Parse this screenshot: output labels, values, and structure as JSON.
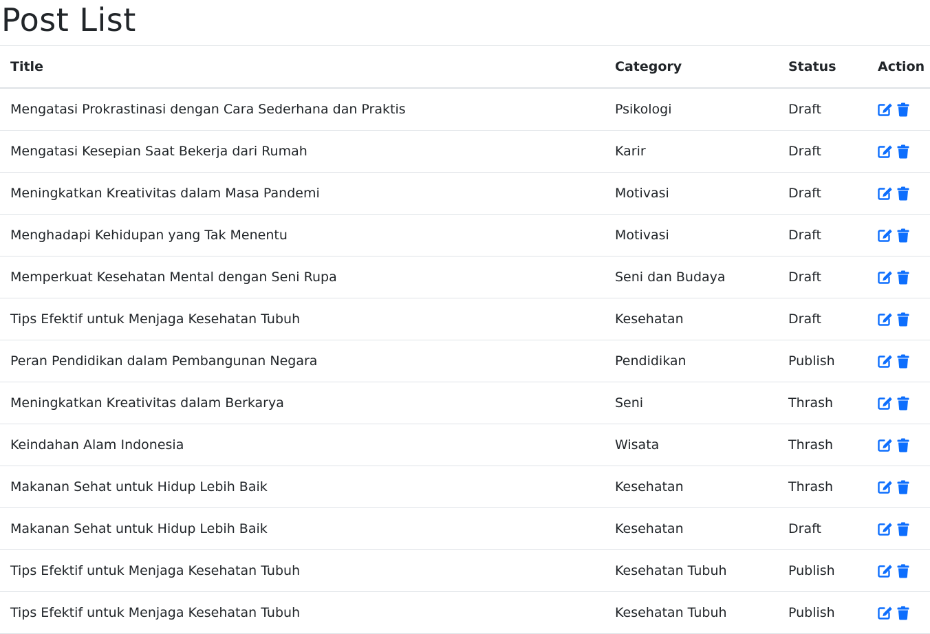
{
  "page": {
    "title": "Post List"
  },
  "table": {
    "headers": {
      "title": "Title",
      "category": "Category",
      "status": "Status",
      "action": "Action"
    },
    "rows": [
      {
        "title": "Mengatasi Prokrastinasi dengan Cara Sederhana dan Praktis",
        "category": "Psikologi",
        "status": "Draft"
      },
      {
        "title": "Mengatasi Kesepian Saat Bekerja dari Rumah",
        "category": "Karir",
        "status": "Draft"
      },
      {
        "title": "Meningkatkan Kreativitas dalam Masa Pandemi",
        "category": "Motivasi",
        "status": "Draft"
      },
      {
        "title": "Menghadapi Kehidupan yang Tak Menentu",
        "category": "Motivasi",
        "status": "Draft"
      },
      {
        "title": "Memperkuat Kesehatan Mental dengan Seni Rupa",
        "category": "Seni dan Budaya",
        "status": "Draft"
      },
      {
        "title": "Tips Efektif untuk Menjaga Kesehatan Tubuh",
        "category": "Kesehatan",
        "status": "Draft"
      },
      {
        "title": "Peran Pendidikan dalam Pembangunan Negara",
        "category": "Pendidikan",
        "status": "Publish"
      },
      {
        "title": "Meningkatkan Kreativitas dalam Berkarya",
        "category": "Seni",
        "status": "Thrash"
      },
      {
        "title": "Keindahan Alam Indonesia",
        "category": "Wisata",
        "status": "Thrash"
      },
      {
        "title": "Makanan Sehat untuk Hidup Lebih Baik",
        "category": "Kesehatan",
        "status": "Thrash"
      },
      {
        "title": "Makanan Sehat untuk Hidup Lebih Baik",
        "category": "Kesehatan",
        "status": "Draft"
      },
      {
        "title": "Tips Efektif untuk Menjaga Kesehatan Tubuh",
        "category": "Kesehatan Tubuh",
        "status": "Publish"
      },
      {
        "title": "Tips Efektif untuk Menjaga Kesehatan Tubuh",
        "category": "Kesehatan Tubuh",
        "status": "Publish"
      }
    ],
    "row_actions": [
      "edit-icon",
      "trash-icon"
    ]
  },
  "colors": {
    "text": "#212529",
    "accent": "#0d6efd",
    "border": "#dee2e6"
  }
}
